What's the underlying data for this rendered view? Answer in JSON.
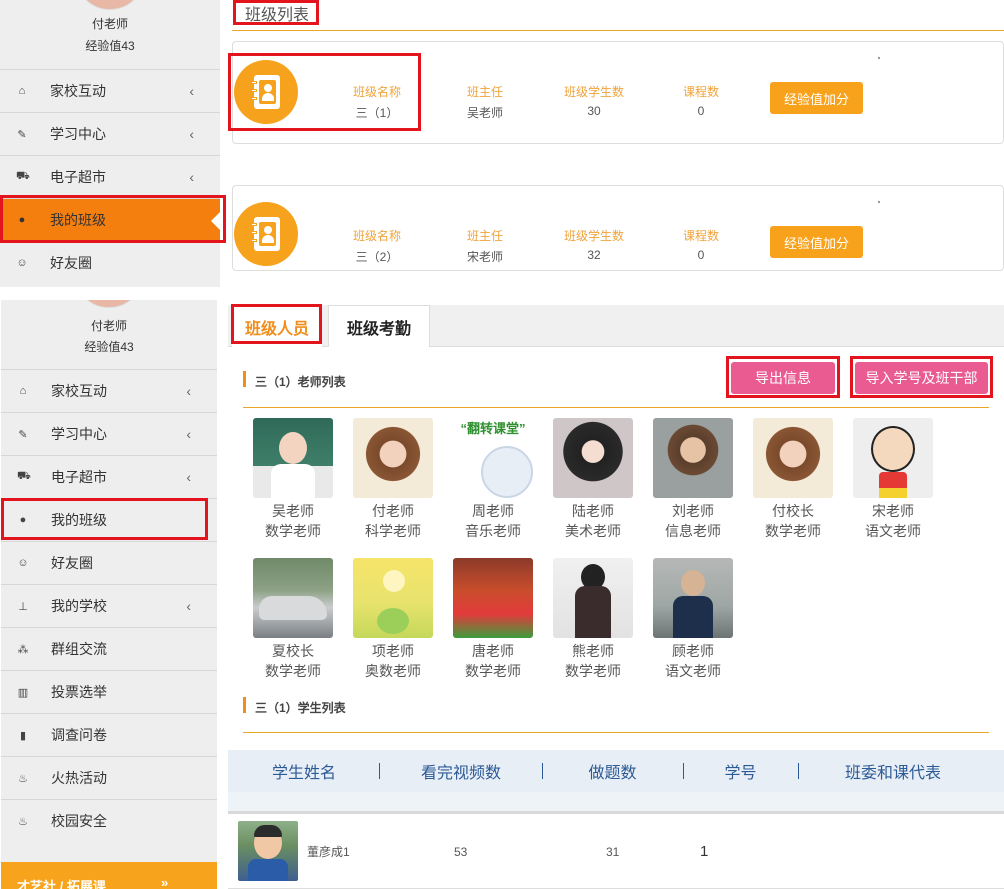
{
  "profile": {
    "name": "付老师",
    "exp": "经验值43"
  },
  "menu_top": [
    {
      "icon": "home-icon",
      "glyph": "⌂",
      "label": "家校互动",
      "chevron": true
    },
    {
      "icon": "edit-icon",
      "glyph": "✎",
      "label": "学习中心",
      "chevron": true
    },
    {
      "icon": "cart-icon",
      "glyph": "⛟",
      "label": "电子超市",
      "chevron": true
    },
    {
      "icon": "user-icon",
      "glyph": "●",
      "label": "我的班级",
      "chevron": false
    },
    {
      "icon": "smile-icon",
      "glyph": "☺",
      "label": "好友圈",
      "chevron": false
    }
  ],
  "menu_bottom": [
    {
      "icon": "home-icon",
      "glyph": "⌂",
      "label": "家校互动",
      "chevron": true
    },
    {
      "icon": "edit-icon",
      "glyph": "✎",
      "label": "学习中心",
      "chevron": true
    },
    {
      "icon": "cart-icon",
      "glyph": "⛟",
      "label": "电子超市",
      "chevron": true
    },
    {
      "icon": "user-icon",
      "glyph": "●",
      "label": "我的班级",
      "chevron": false
    },
    {
      "icon": "smile-icon",
      "glyph": "☺",
      "label": "好友圈",
      "chevron": false
    },
    {
      "icon": "sitemap-icon",
      "glyph": "⊥",
      "label": "我的学校",
      "chevron": true
    },
    {
      "icon": "group-icon",
      "glyph": "⁂",
      "label": "群组交流",
      "chevron": false
    },
    {
      "icon": "bar-chart-icon",
      "glyph": "▥",
      "label": "投票选举",
      "chevron": false
    },
    {
      "icon": "file-icon",
      "glyph": "▮",
      "label": "调查问卷",
      "chevron": false
    },
    {
      "icon": "fire-icon",
      "glyph": "♨",
      "label": "火热活动",
      "chevron": false
    },
    {
      "icon": "shield-icon",
      "glyph": "♨",
      "label": "校园安全",
      "chevron": false
    }
  ],
  "chevron_glyph": "‹",
  "banner": {
    "label": "才艺社 / 拓展课",
    "arrow": "»"
  },
  "class_list": {
    "title": "班级列表",
    "labels": {
      "name": "班级名称",
      "teacher": "班主任",
      "students": "班级学生数",
      "courses": "课程数"
    },
    "button": "经验值加分",
    "classes": [
      {
        "name": "三（1）",
        "teacher": "吴老师",
        "students": "30",
        "courses": "0"
      },
      {
        "name": "三（2）",
        "teacher": "宋老师",
        "students": "32",
        "courses": "0"
      }
    ]
  },
  "tabs": [
    "班级人员",
    "班级考勤"
  ],
  "teacher_section": {
    "title": "三（1）老师列表",
    "export_button": "导出信息",
    "import_button": "导入学号及班干部",
    "photo_caption": "“翻转课堂”",
    "teachers": [
      {
        "name": "吴老师",
        "role": "数学老师"
      },
      {
        "name": "付老师",
        "role": "科学老师"
      },
      {
        "name": "周老师",
        "role": "音乐老师"
      },
      {
        "name": "陆老师",
        "role": "美术老师"
      },
      {
        "name": "刘老师",
        "role": "信息老师"
      },
      {
        "name": "付校长",
        "role": "数学老师"
      },
      {
        "name": "宋老师",
        "role": "语文老师"
      },
      {
        "name": "夏校长",
        "role": "数学老师"
      },
      {
        "name": "项老师",
        "role": "奥数老师"
      },
      {
        "name": "唐老师",
        "role": "数学老师"
      },
      {
        "name": "熊老师",
        "role": "数学老师"
      },
      {
        "name": "顾老师",
        "role": "语文老师"
      }
    ]
  },
  "student_section": {
    "title": "三（1）学生列表",
    "columns": [
      "学生姓名",
      "看完视频数",
      "做题数",
      "学号",
      "班委和课代表"
    ],
    "rows": [
      {
        "name": "董彦成1",
        "videos": "53",
        "questions": "31",
        "id": "1"
      }
    ]
  },
  "colors": {
    "accent": "#f47f0f",
    "button_orange": "#f8a21b",
    "button_pink": "#e95b91",
    "highlight_red": "#e3141e"
  }
}
